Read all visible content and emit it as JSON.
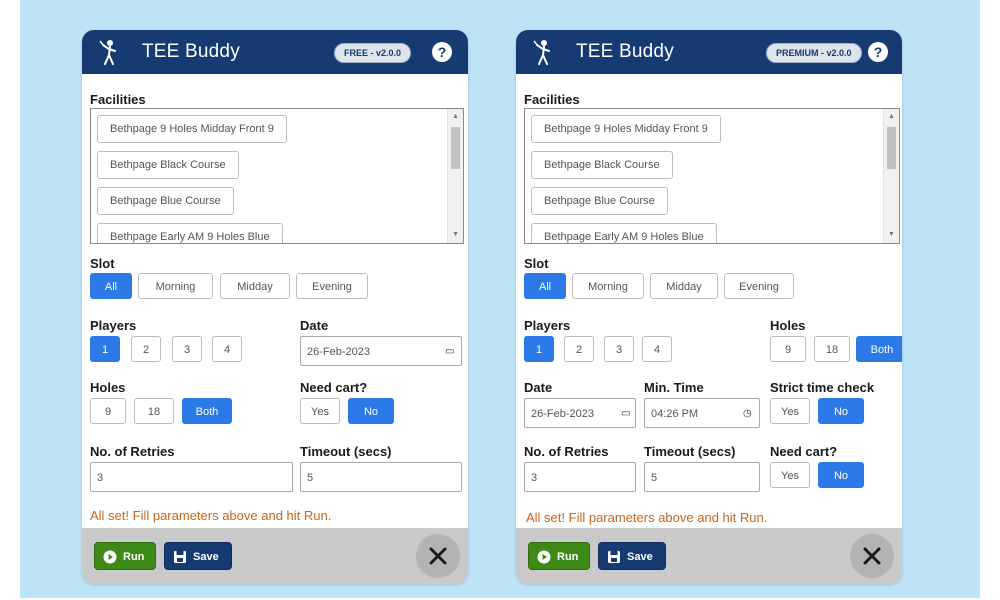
{
  "free": {
    "app_title": "TEE Buddy",
    "version_badge": "FREE - v2.0.0",
    "help_icon": "?",
    "facilities_label": "Facilities",
    "facilities": [
      "Bethpage 9 Holes Midday Front 9",
      "Bethpage Black Course",
      "Bethpage Blue Course",
      "Bethpage Early AM 9 Holes Blue"
    ],
    "slot_label": "Slot",
    "slot_options": [
      "All",
      "Morning",
      "Midday",
      "Evening"
    ],
    "slot_selected": "All",
    "players_label": "Players",
    "players_options": [
      "1",
      "2",
      "3",
      "4"
    ],
    "players_selected": "1",
    "date_label": "Date",
    "date_value": "26-Feb-2023",
    "holes_label": "Holes",
    "holes_options": [
      "9",
      "18",
      "Both"
    ],
    "holes_selected": "Both",
    "cart_label": "Need cart?",
    "cart_options": [
      "Yes",
      "No"
    ],
    "cart_selected": "No",
    "retries_label": "No. of Retries",
    "retries_value": "3",
    "timeout_label": "Timeout (secs)",
    "timeout_value": "5",
    "status_message": "All set! Fill parameters above and hit Run.",
    "run_label": "Run",
    "save_label": "Save"
  },
  "premium": {
    "app_title": "TEE Buddy",
    "version_badge": "PREMIUM - v2.0.0",
    "help_icon": "?",
    "facilities_label": "Facilities",
    "facilities": [
      "Bethpage 9 Holes Midday Front 9",
      "Bethpage Black Course",
      "Bethpage Blue Course",
      "Bethpage Early AM 9 Holes Blue"
    ],
    "slot_label": "Slot",
    "slot_options": [
      "All",
      "Morning",
      "Midday",
      "Evening"
    ],
    "slot_selected": "All",
    "players_label": "Players",
    "players_options": [
      "1",
      "2",
      "3",
      "4"
    ],
    "players_selected": "1",
    "holes_label": "Holes",
    "holes_options": [
      "9",
      "18",
      "Both"
    ],
    "holes_selected": "Both",
    "date_label": "Date",
    "date_value": "26-Feb-2023",
    "min_time_label": "Min. Time",
    "min_time_value": "04:26 PM",
    "strict_label": "Strict time check",
    "strict_options": [
      "Yes",
      "No"
    ],
    "strict_selected": "No",
    "retries_label": "No. of Retries",
    "retries_value": "3",
    "timeout_label": "Timeout (secs)",
    "timeout_value": "5",
    "cart_label": "Need cart?",
    "cart_options": [
      "Yes",
      "No"
    ],
    "cart_selected": "No",
    "status_message": "All set! Fill parameters above and hit Run.",
    "run_label": "Run",
    "save_label": "Save"
  },
  "colors": {
    "header": "#163a72",
    "accent_blue": "#2b7ae8",
    "run_green": "#3d8a17",
    "status_orange": "#c8651b",
    "backdrop": "#bde3f7",
    "footer": "#c9c9c9"
  },
  "icons": [
    "golfer-icon",
    "help-icon",
    "calendar-icon",
    "clock-icon",
    "play-icon",
    "save-icon",
    "close-icon",
    "scroll-up-icon",
    "scroll-down-icon"
  ]
}
